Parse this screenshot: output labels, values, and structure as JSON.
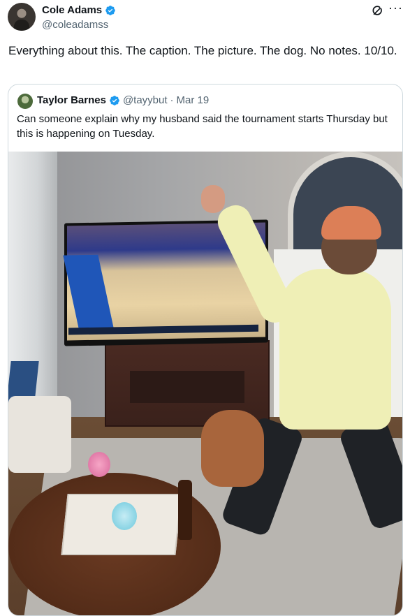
{
  "post": {
    "author_name": "Cole Adams",
    "author_handle": "@coleadamss",
    "text": "Everything about this. The caption. The picture. The dog. No notes. 10/10.",
    "more_label": "···"
  },
  "quote": {
    "author_name": "Taylor Barnes",
    "author_handle": "@tayybut",
    "separator": "·",
    "date": "Mar 19",
    "text": "Can someone explain why my husband said the tournament starts Thursday but this is happening on Tuesday."
  },
  "colors": {
    "verified": "#1d9bf0",
    "secondary_text": "#536471",
    "border": "#cfd9de"
  },
  "icons": {
    "verified": "verified-badge-icon",
    "grok": "grok-icon",
    "more": "more-icon"
  }
}
